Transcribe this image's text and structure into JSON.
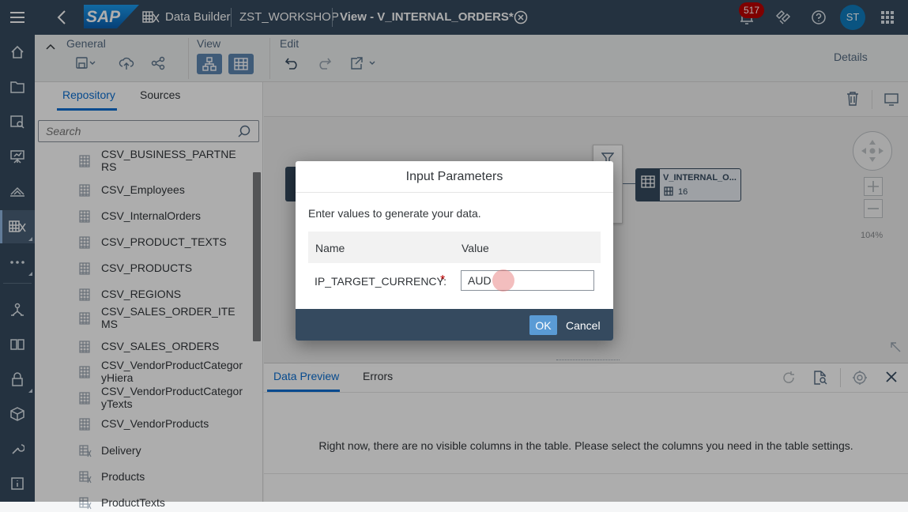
{
  "shell": {
    "logo_text": "SAP",
    "app_name": "Data Builder",
    "space": "ZST_WORKSHOP",
    "view_title": "View - V_INTERNAL_ORDERS*",
    "notification_count": "517",
    "avatar_initials": "ST"
  },
  "toolbar": {
    "group_general": "General",
    "group_view": "View",
    "group_edit": "Edit",
    "details": "Details"
  },
  "left": {
    "tab_repository": "Repository",
    "tab_sources": "Sources",
    "search_placeholder": "Search",
    "items": [
      {
        "label": "CSV_BUSINESS_PARTNERS",
        "icon": "table-icon"
      },
      {
        "label": "CSV_Employees",
        "icon": "table-icon"
      },
      {
        "label": "CSV_InternalOrders",
        "icon": "table-icon"
      },
      {
        "label": "CSV_PRODUCT_TEXTS",
        "icon": "table-icon"
      },
      {
        "label": "CSV_PRODUCTS",
        "icon": "table-icon"
      },
      {
        "label": "CSV_REGIONS",
        "icon": "table-icon"
      },
      {
        "label": "CSV_SALES_ORDER_ITEMS",
        "icon": "table-icon"
      },
      {
        "label": "CSV_SALES_ORDERS",
        "icon": "table-icon"
      },
      {
        "label": "CSV_VendorProductCategoryHiera",
        "icon": "table-icon"
      },
      {
        "label": "CSV_VendorProductCategoryTexts",
        "icon": "table-icon"
      },
      {
        "label": "CSV_VendorProducts",
        "icon": "table-icon"
      },
      {
        "label": "Delivery",
        "icon": "view-icon"
      },
      {
        "label": "Products",
        "icon": "view-icon"
      },
      {
        "label": "ProductTexts",
        "icon": "view-icon"
      }
    ]
  },
  "canvas": {
    "node_title": "V_INTERNAL_O...",
    "node_count": "16",
    "zoom": "104%"
  },
  "bottom": {
    "tab_preview": "Data Preview",
    "tab_errors": "Errors",
    "empty_message": "Right now, there are no visible columns in the table. Please select the columns you need in the table settings."
  },
  "dialog": {
    "title": "Input Parameters",
    "intro": "Enter values to generate your data.",
    "col_name": "Name",
    "col_value": "Value",
    "param_name": "IP_TARGET_CURRENCY:",
    "required_mark": "*",
    "param_value": "AUD",
    "ok": "OK",
    "cancel": "Cancel"
  },
  "colors": {
    "shell": "#354a5f",
    "accent": "#0a6ed1",
    "required": "#bb0000",
    "ok_button": "#5a9bd5"
  }
}
